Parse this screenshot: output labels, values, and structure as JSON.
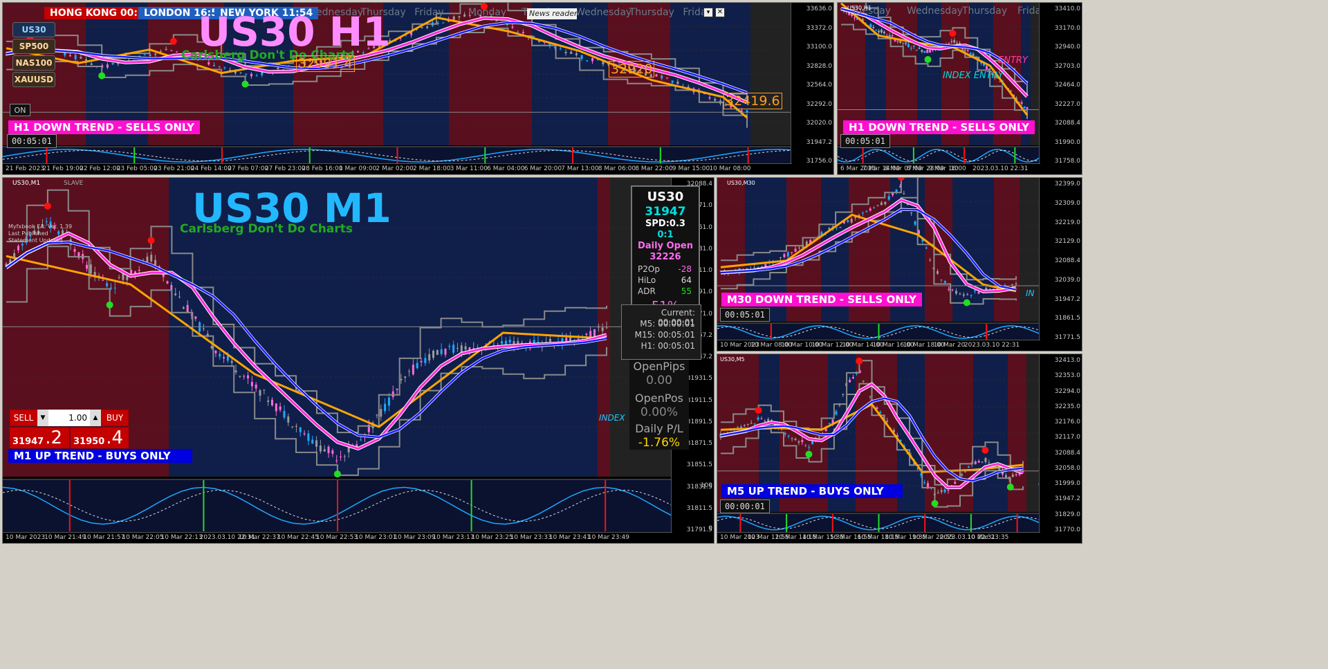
{
  "clocks": [
    {
      "label": "HONG KONG",
      "time": "00:54",
      "bg": "#c40000"
    },
    {
      "label": "LONDON",
      "time": "16:54",
      "bg": "#1f5fbf"
    },
    {
      "label": "NEW YORK",
      "time": "11:54",
      "bg": "#1f5fbf"
    }
  ],
  "news_reader": "News reader",
  "symbols": [
    "US30",
    "SP500",
    "NAS100",
    "XAUUSD"
  ],
  "on_label": "ON",
  "chart_data": [
    {
      "type": "line",
      "title": "US30 H1",
      "subtitle": "Carlsberg Don't Do Charts",
      "trend_label": "H1  DOWN TREND - SELLS ONLY",
      "timer": "00:05:01",
      "weekday_labels": [
        "Wednesday",
        "Thursday",
        "Friday",
        "Monday",
        "Tuesday",
        "Wednesday",
        "Thursday",
        "Friday"
      ],
      "price_labels": [
        "33636.0",
        "33372.0",
        "33100.0",
        "32828.0",
        "32564.0",
        "32292.0",
        "32020.0",
        "31947.2",
        "31756.0"
      ],
      "price_boxes": [
        "32991.4",
        "32920",
        "32419.6"
      ],
      "time_labels": [
        "21 Feb 2023",
        "21 Feb 19:00",
        "22 Feb 12:00",
        "23 Feb 05:00",
        "23 Feb 21:00",
        "24 Feb 14:00",
        "27 Feb 07:00",
        "27 Feb 23:00",
        "28 Feb 16:00",
        "1 Mar 09:00",
        "2 Mar 02:00",
        "2 Mar 18:00",
        "3 Mar 11:00",
        "6 Mar 04:00",
        "6 Mar 20:00",
        "7 Mar 13:00",
        "8 Mar 06:00",
        "8 Mar 22:00",
        "9 Mar 15:00",
        "10 Mar 08:00"
      ],
      "ylim": [
        31756,
        33700
      ],
      "values": [
        33020,
        33120,
        33060,
        32960,
        32820,
        32900,
        33000,
        33080,
        32960,
        32820,
        32700,
        32760,
        32840,
        32920,
        32980,
        33060,
        33180,
        33320,
        33460,
        33550,
        33580,
        33420,
        33260,
        33100,
        32980,
        32880,
        32800,
        32720,
        32620,
        32460,
        32320,
        32180
      ]
    },
    {
      "type": "line",
      "trend_label": "H1  DOWN TREND - SELLS ONLY",
      "timer": "00:05:01",
      "header": "US30,H1",
      "weekday_labels": [
        "Tuesday",
        "Wednesday",
        "Thursday",
        "Friday"
      ],
      "price_labels": [
        "33410.0",
        "33170.0",
        "32940.0",
        "32703.0",
        "32464.0",
        "32227.0",
        "32088.4",
        "31990.0",
        "31758.0"
      ],
      "time_labels": [
        "6 Mar 2023",
        "7 Mar 14:00",
        "8 Mar 07:00",
        "8 Mar 23:00",
        "9 Mar 16:00",
        "10",
        "2023.03.10 22:31"
      ],
      "annotations": [
        "ENTRY",
        "INDEX ENTRY"
      ],
      "ylim": [
        31758,
        33410
      ],
      "values": [
        33380,
        33300,
        33200,
        33120,
        33040,
        32960,
        32900,
        32860,
        32920,
        32980,
        32900,
        32780,
        32620,
        32480,
        32300,
        32150
      ]
    },
    {
      "type": "line",
      "title": "US30 M1",
      "subtitle": "Carlsberg Don't Do Charts",
      "trend_label": "M1 UP TREND - BUYS ONLY",
      "header": "US30,M1",
      "mode": "SLAVE",
      "ea_lines": [
        "Myfxbook EA: Ver. 1.39",
        "Last Published",
        "Statement Updated"
      ],
      "axis_tag": "INDEX",
      "price_labels": [
        "32088.4",
        "32071.0",
        "32051.0",
        "32031.0",
        "32011.0",
        "31991.0",
        "31971.0",
        "31957.2",
        "31947.2",
        "31931.5",
        "31911.5",
        "31891.5",
        "31871.5",
        "31851.5",
        "31831.5",
        "31811.5",
        "31791.5"
      ],
      "time_labels": [
        "10 Mar 2023",
        "10 Mar 21:49",
        "10 Mar 21:57",
        "10 Mar 22:05",
        "10 Mar 22:13",
        "2023.03.10 22:31",
        "10 Mar 22:37",
        "10 Mar 22:45",
        "10 Mar 22:53",
        "10 Mar 23:01",
        "10 Mar 23:09",
        "10 Mar 23:17",
        "10 Mar 23:25",
        "10 Mar 23:33",
        "10 Mar 23:41",
        "10 Mar 23:49"
      ],
      "osc_labels": [
        "100",
        "0"
      ],
      "ylim": [
        31791,
        32088
      ],
      "values": [
        32000,
        32030,
        32045,
        32030,
        32000,
        31980,
        31995,
        32010,
        31980,
        31950,
        31920,
        31900,
        31880,
        31860,
        31840,
        31820,
        31808,
        31820,
        31850,
        31880,
        31905,
        31915,
        31918,
        31920,
        31922,
        31922,
        31923,
        31925,
        31930,
        31940
      ]
    },
    {
      "type": "line",
      "trend_label": "M30  DOWN TREND - SELLS ONLY",
      "timer": "00:05:01",
      "header": "US30,M30",
      "axis_tag": "IN",
      "price_labels": [
        "32399.0",
        "32309.0",
        "32219.0",
        "32129.0",
        "32088.4",
        "32039.0",
        "31947.2",
        "31861.5",
        "31771.5"
      ],
      "time_labels": [
        "10 Mar 2023",
        "10 Mar 08:00",
        "10 Mar 10:00",
        "10 Mar 12:00",
        "10 Mar 14:00",
        "10 Mar 16:00",
        "10 Mar 18:00",
        "10 Mar 20",
        "2023.03.10 22:31"
      ],
      "ylim": [
        31771,
        32399
      ],
      "values": [
        31980,
        31990,
        32000,
        32020,
        32060,
        32100,
        32150,
        32190,
        32220,
        32260,
        32300,
        32380,
        32180,
        32000,
        31900,
        31880,
        31900,
        31910,
        31920
      ]
    },
    {
      "type": "line",
      "trend_label": "M5 UP TREND - BUYS ONLY",
      "timer": "00:00:01",
      "header": "US30,M5",
      "axis_tag": "IN",
      "price_labels": [
        "32413.0",
        "32353.0",
        "32294.0",
        "32235.0",
        "32176.0",
        "32117.0",
        "32088.4",
        "32058.0",
        "31999.0",
        "31947.2",
        "31829.0",
        "31770.0"
      ],
      "time_labels": [
        "10 Mar 2023",
        "10 Mar 12:55",
        "10 Mar 14:15",
        "10 Mar 15:35",
        "10 Mar 16:55",
        "10 Mar 18:15",
        "10 Mar 19:35",
        "10 Mar 20:55",
        "2023.03.10 22:31",
        "10 Mar 23:35"
      ],
      "ylim": [
        31770,
        32413
      ],
      "values": [
        32080,
        32100,
        32120,
        32150,
        32140,
        32100,
        32060,
        32040,
        32080,
        32150,
        32300,
        32360,
        32240,
        32150,
        32080,
        32000,
        31900,
        31830,
        31850,
        31900,
        31960,
        31980,
        31940,
        31900,
        31930
      ]
    }
  ],
  "trade_panel": {
    "sell": "SELL",
    "buy": "BUY",
    "lot": "1.00",
    "sell_small": "31947",
    "sell_big": ".2",
    "buy_small": "31950",
    "buy_big": ".4"
  },
  "info_box": {
    "symbol": "US30",
    "price": "31947",
    "spd": "SPD:0.3",
    "ratio": "0:1",
    "daily_open_label": "Daily Open",
    "daily_open": "32226",
    "p2op_label": "P2Op",
    "p2op": "-28",
    "hilo_label": "HiLo",
    "hilo": "64",
    "adr_label": "ADR",
    "adr": "55",
    "pct": "51%"
  },
  "timeframes": [
    {
      "label": "Current:",
      "value": "00:00:01"
    },
    {
      "label": "M5:",
      "value": "00:00:01"
    },
    {
      "label": "M15:",
      "value": "00:05:01"
    },
    {
      "label": "H1:",
      "value": "00:05:01"
    }
  ],
  "right_info": {
    "open_pips_label": "OpenPips",
    "open_pips": "0.00",
    "open_pos_label": "OpenPos",
    "open_pos": "0.00%",
    "daily_pl_label": "Daily P/L",
    "daily_pl": "-1.76%"
  },
  "colors": {
    "maroon": "#5a0f1e",
    "navy": "#0f1f4a",
    "magenta": "#ff2bd6",
    "blue": "#1a1aff",
    "orange": "#ffa500",
    "green": "#22dd22",
    "red": "#ff1010",
    "sky": "#00aaff"
  }
}
